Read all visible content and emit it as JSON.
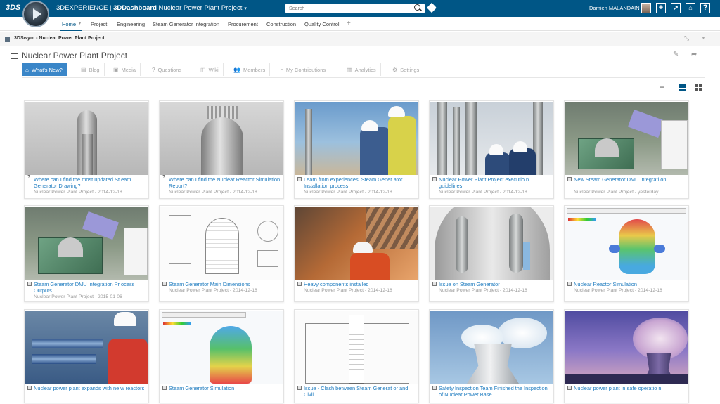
{
  "topbar": {
    "brand_mark": "3DS",
    "app_name": "3DEXPERIENCE | ",
    "app_product": "3DDashboard",
    "dashboard_name": " Nuclear Power Plant Project",
    "search_placeholder": "Search",
    "user_name": "Damien MALANDAIN",
    "btn_add": "+",
    "btn_help": "?"
  },
  "tabs": [
    {
      "label": "Home"
    },
    {
      "label": "Project"
    },
    {
      "label": "Engineering"
    },
    {
      "label": "Steam Generator Integration"
    },
    {
      "label": "Procurement"
    },
    {
      "label": "Construction"
    },
    {
      "label": "Quality Control"
    },
    {
      "label": "+"
    }
  ],
  "widget": {
    "title": "3DSwym - Nuclear Power Plant Project",
    "community_title": "Nuclear Power Plant Project"
  },
  "navtabs": [
    {
      "label": "What's New?",
      "icon": "home-icon",
      "glyph": "⌂"
    },
    {
      "label": "Blog",
      "icon": "blog-icon",
      "glyph": "▤"
    },
    {
      "label": "Media",
      "icon": "media-icon",
      "glyph": "▣"
    },
    {
      "label": "Questions",
      "icon": "question-icon",
      "glyph": "?"
    },
    {
      "label": "Wiki",
      "icon": "wiki-icon",
      "glyph": "◫"
    },
    {
      "label": "Members",
      "icon": "members-icon",
      "glyph": "👥"
    },
    {
      "label": "My Contributions",
      "icon": "contributions-icon",
      "glyph": "◔"
    },
    {
      "label": "Analytics",
      "icon": "analytics-icon",
      "glyph": "▥"
    },
    {
      "label": "Settings",
      "icon": "settings-icon",
      "glyph": "⚙"
    }
  ],
  "cards": [
    {
      "title": "Where can I find the most updated St eam Generator Drawing?",
      "meta": "Nuclear Power Plant Project - 2014-12-18",
      "type": "question"
    },
    {
      "title": "Where can I find the Nuclear Reactor Simulation Report?",
      "meta": "Nuclear Power Plant Project - 2014-12-18",
      "type": "question"
    },
    {
      "title": "Learn from experiences: Steam Gener ator Installation process",
      "meta": "Nuclear Power Plant Project - 2014-12-18",
      "type": "post"
    },
    {
      "title": "Nuclear Power Plant Project executio n guidelines",
      "meta": "Nuclear Power Plant Project - 2014-12-18",
      "type": "post"
    },
    {
      "title": "New Steam Generator DMU Integrati on",
      "meta": "Nuclear Power Plant Project - yesterday",
      "type": "post"
    },
    {
      "title": "Steam Generator DMU Integration Pr ocess Outputs",
      "meta": "Nuclear Power Plant Project - 2015-01-06",
      "type": "post"
    },
    {
      "title": "Steam Generator Main Dimensions",
      "meta": "Nuclear Power Plant Project - 2014-12-18",
      "type": "post"
    },
    {
      "title": "Heavy components installed",
      "meta": "Nuclear Power Plant Project - 2014-12-18",
      "type": "post"
    },
    {
      "title": "Issue on Steam Generator",
      "meta": "Nuclear Power Plant Project - 2014-12-18",
      "type": "post"
    },
    {
      "title": "Nuclear Reactor Simulation",
      "meta": "Nuclear Power Plant Project - 2014-12-18",
      "type": "post"
    },
    {
      "title": "Nuclear power plant expands with ne w reactors",
      "meta": "",
      "type": "post"
    },
    {
      "title": "Steam Generator Simulation",
      "meta": "",
      "type": "post"
    },
    {
      "title": "Issue - Clash between Steam Generat or and Civil",
      "meta": "",
      "type": "post"
    },
    {
      "title": "Safety Inspection Team Finished the Inspection of Nuclear Power Base",
      "meta": "",
      "type": "post"
    },
    {
      "title": "Nuclear power plant in safe operatio n",
      "meta": "",
      "type": "post"
    }
  ],
  "colors": {
    "brand": "#005686",
    "accent": "#3a86c8",
    "link": "#1d7bbf"
  }
}
